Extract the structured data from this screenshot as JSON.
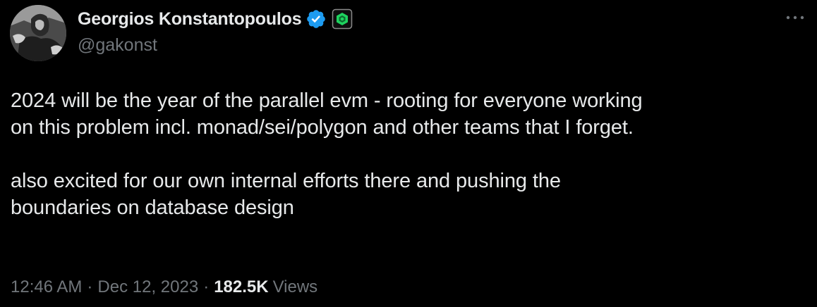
{
  "author": {
    "display_name": "Georgios Konstantopoulos",
    "handle": "@gakonst",
    "avatar_icon": "avatar-image",
    "verified_icon": "verified-badge-icon",
    "affiliation_icon": "affiliation-badge-icon"
  },
  "tweet": {
    "paragraphs": [
      "2024 will be the year of the parallel evm - rooting for everyone working\non this problem incl. monad/sei/polygon and other teams that I forget.",
      "also excited for our own internal efforts there and pushing the\nboundaries on database design"
    ]
  },
  "meta": {
    "time": "12:46 AM",
    "separator": "·",
    "date": "Dec 12, 2023",
    "views_count": "182.5K",
    "views_label": "Views"
  },
  "colors": {
    "background": "#000000",
    "text_primary": "#e7e9ea",
    "text_secondary": "#71767b",
    "verified_blue": "#1d9bf0",
    "affiliation_green": "#1fd35f"
  },
  "more_icon": "more-horizontal-icon"
}
